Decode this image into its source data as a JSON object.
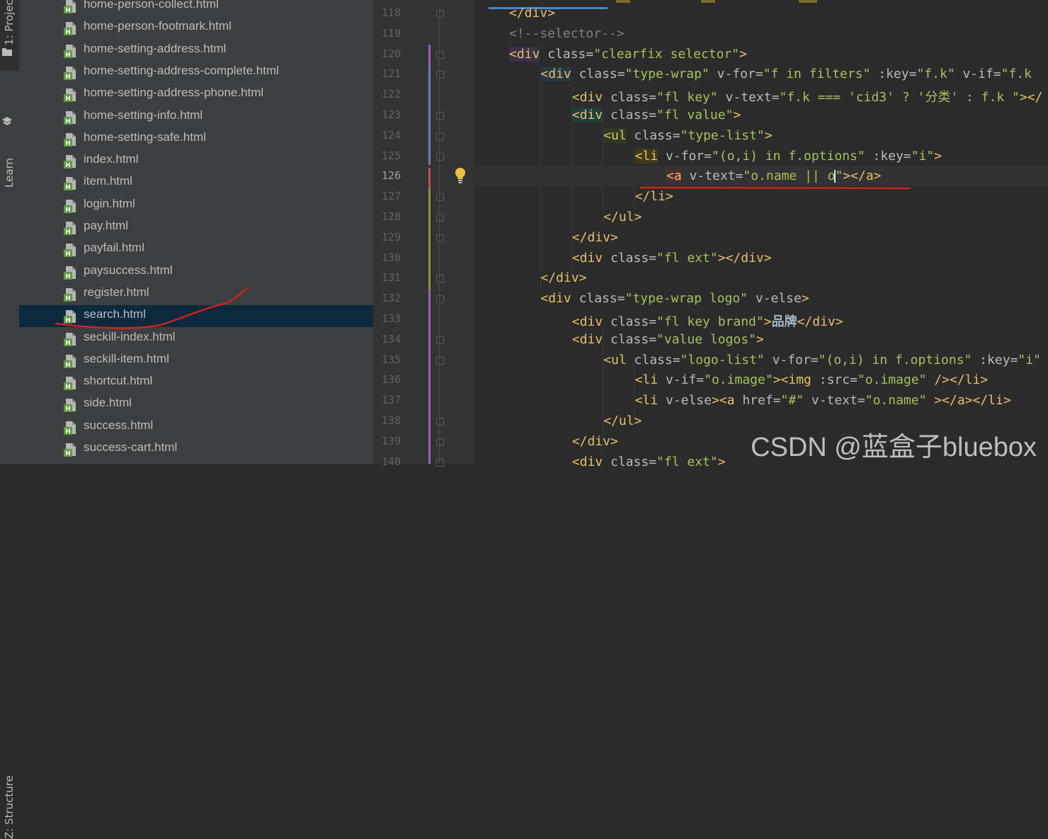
{
  "tool_window_tabs": {
    "project": "1: Project",
    "learn": "Learn",
    "structure": "Z: Structure"
  },
  "project_files": [
    {
      "name": "home-person-collect.html",
      "selected": false
    },
    {
      "name": "home-person-footmark.html",
      "selected": false
    },
    {
      "name": "home-setting-address.html",
      "selected": false
    },
    {
      "name": "home-setting-address-complete.html",
      "selected": false
    },
    {
      "name": "home-setting-address-phone.html",
      "selected": false
    },
    {
      "name": "home-setting-info.html",
      "selected": false
    },
    {
      "name": "home-setting-safe.html",
      "selected": false
    },
    {
      "name": "index.html",
      "selected": false
    },
    {
      "name": "item.html",
      "selected": false
    },
    {
      "name": "login.html",
      "selected": false
    },
    {
      "name": "pay.html",
      "selected": false
    },
    {
      "name": "payfail.html",
      "selected": false
    },
    {
      "name": "paysuccess.html",
      "selected": false
    },
    {
      "name": "register.html",
      "selected": false
    },
    {
      "name": "search.html",
      "selected": true
    },
    {
      "name": "seckill-index.html",
      "selected": false
    },
    {
      "name": "seckill-item.html",
      "selected": false
    },
    {
      "name": "shortcut.html",
      "selected": false
    },
    {
      "name": "side.html",
      "selected": false
    },
    {
      "name": "success.html",
      "selected": false
    },
    {
      "name": "success-cart.html",
      "selected": false
    }
  ],
  "editor": {
    "current_line": 126,
    "line_numbers": [
      "118",
      "119",
      "120",
      "121",
      "122",
      "123",
      "124",
      "125",
      "126",
      "127",
      "128",
      "129",
      "130",
      "131",
      "132",
      "133",
      "134",
      "135",
      "136",
      "137",
      "138",
      "139",
      "140"
    ],
    "lines": [
      "</div>",
      "<!--selector-->",
      "<div class=\"clearfix selector\">",
      "<div class=\"type-wrap\" v-for=\"f in filters\" :key=\"f.k\" v-if=\"f.k",
      "<div class=\"fl key\" v-text=\"f.k === 'cid3' ? '分类' : f.k \"></",
      "<div class=\"fl value\">",
      "<ul class=\"type-list\">",
      "<li v-for=\"(o,i) in f.options\" :key=\"i\">",
      "<a v-text=\"o.name || o\"></a>",
      "</li>",
      "</ul>",
      "</div>",
      "<div class=\"fl ext\"></div>",
      "</div>",
      "<div class=\"type-wrap logo\" v-else>",
      "<div class=\"fl key brand\">品牌</div>",
      "<div class=\"value logos\">",
      "<ul class=\"logo-list\" v-for=\"(o,i) in f.options\" :key=\"i\"",
      "<li v-if=\"o.image\"><img :src=\"o.image\" /></li>",
      "<li v-else><a href=\"#\" v-text=\"o.name\" ></a></li>",
      "</ul>",
      "</div>",
      "<div class=\"fl ext\">"
    ]
  },
  "watermark": "CSDN @蓝盒子bluebox",
  "colors": {
    "background": "#2b2b2b",
    "panel": "#3c3f41",
    "selection": "#0d293e",
    "tag": "#e8bf6a",
    "string": "#a5c25c",
    "annotation_red": "#e0201a"
  }
}
